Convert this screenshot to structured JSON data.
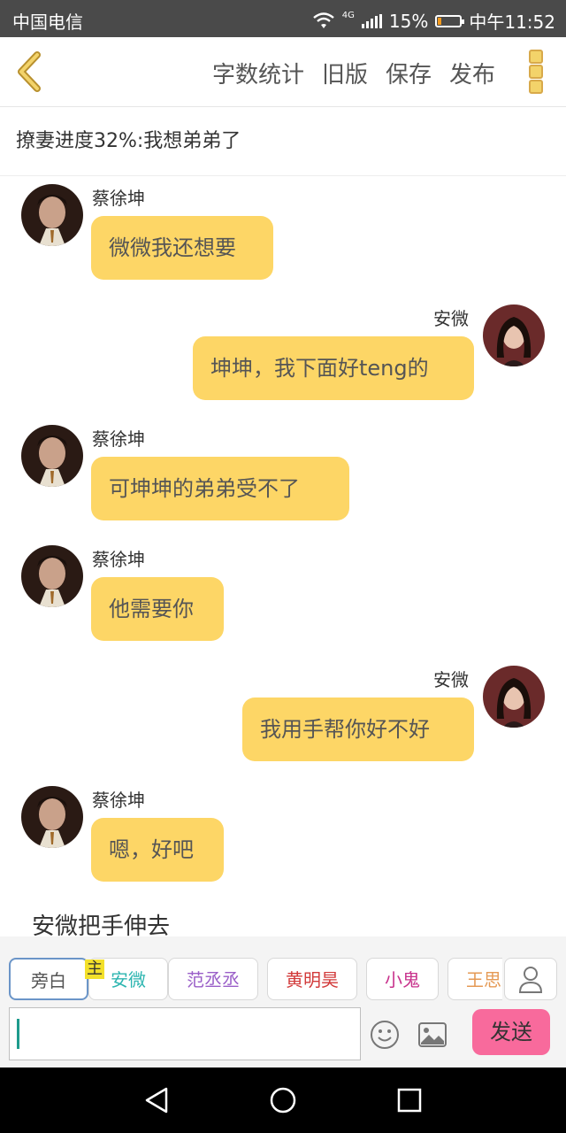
{
  "statusbar": {
    "carrier": "中国电信",
    "network": "4G",
    "battery_percent": "15%",
    "battery_level": 0.15,
    "time": "中午11:52"
  },
  "toolbar": {
    "actions": [
      "字数统计",
      "旧版",
      "保存",
      "发布"
    ]
  },
  "subtitle": "撩妻进度32%:我想弟弟了",
  "messages": [
    {
      "side": "left",
      "name": "蔡徐坤",
      "text": "微微我还想要"
    },
    {
      "side": "right",
      "name": "安微",
      "text": "坤坤，我下面好teng的"
    },
    {
      "side": "left",
      "name": "蔡徐坤",
      "text": "可坤坤的弟弟受不了"
    },
    {
      "side": "left",
      "name": "蔡徐坤",
      "text": "他需要你"
    },
    {
      "side": "right",
      "name": "安微",
      "text": "我用手帮你好不好"
    },
    {
      "side": "left",
      "name": "蔡徐坤",
      "text": "嗯，好吧"
    }
  ],
  "narration": "安微把手伸去",
  "characters": [
    {
      "label": "旁白",
      "color": "#555555"
    },
    {
      "label": "安微",
      "color": "#2cb5b0"
    },
    {
      "label": "范丞丞",
      "color": "#9a5fc8"
    },
    {
      "label": "黄明昊",
      "color": "#d23a3a"
    },
    {
      "label": "小鬼",
      "color": "#c8328c"
    },
    {
      "label": "王思",
      "color": "#e59a55"
    }
  ],
  "main_tag": "主",
  "send_label": "发送",
  "colors": {
    "bubble": "#fdd666",
    "send": "#f86a9c",
    "accent": "#d8a94a"
  }
}
